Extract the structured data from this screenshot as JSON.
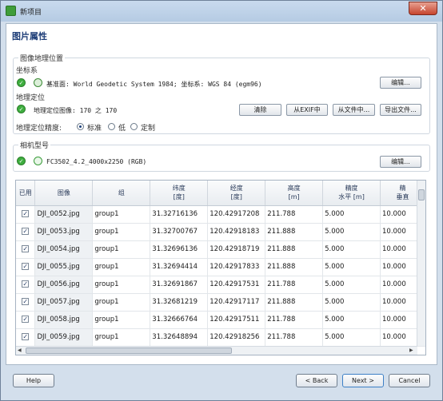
{
  "window": {
    "title": "新项目",
    "close_label": "✕"
  },
  "page_title": "图片属性",
  "geolocation_group": {
    "legend": "图像地理位置",
    "coordinate_system": {
      "label": "坐标系",
      "value": "基准面: World Geodetic System 1984; 坐标系: WGS 84 (egm96)",
      "edit_button": "编辑..."
    },
    "geolocation": {
      "label": "地理定位",
      "value": "地理定位图像: 170 之 170",
      "buttons": [
        "清除",
        "从EXIF中",
        "从文件中...",
        "导出文件..."
      ]
    },
    "accuracy": {
      "label": "地理定位精度:",
      "options": [
        "标准",
        "低",
        "定制"
      ],
      "selected": "标准"
    }
  },
  "camera_group": {
    "legend": "相机型号",
    "value": "FC3502_4.2_4000x2250 (RGB)",
    "edit_button": "编辑..."
  },
  "table": {
    "columns": [
      "已用",
      "图像",
      "组",
      "纬度\n[度]",
      "经度\n[度]",
      "高度\n[m]",
      "精度\n水平 [m]",
      "精\n垂直"
    ],
    "rows": [
      {
        "checked": true,
        "image": "DJI_0052.jpg",
        "group": "group1",
        "lat": "31.32716136",
        "lon": "120.42917208",
        "alt": "211.788",
        "h_acc": "5.000",
        "v_acc": "10.000"
      },
      {
        "checked": true,
        "image": "DJI_0053.jpg",
        "group": "group1",
        "lat": "31.32700767",
        "lon": "120.42918183",
        "alt": "211.888",
        "h_acc": "5.000",
        "v_acc": "10.000"
      },
      {
        "checked": true,
        "image": "DJI_0054.jpg",
        "group": "group1",
        "lat": "31.32696136",
        "lon": "120.42918719",
        "alt": "211.888",
        "h_acc": "5.000",
        "v_acc": "10.000"
      },
      {
        "checked": true,
        "image": "DJI_0055.jpg",
        "group": "group1",
        "lat": "31.32694414",
        "lon": "120.42917833",
        "alt": "211.888",
        "h_acc": "5.000",
        "v_acc": "10.000"
      },
      {
        "checked": true,
        "image": "DJI_0056.jpg",
        "group": "group1",
        "lat": "31.32691867",
        "lon": "120.42917531",
        "alt": "211.788",
        "h_acc": "5.000",
        "v_acc": "10.000"
      },
      {
        "checked": true,
        "image": "DJI_0057.jpg",
        "group": "group1",
        "lat": "31.32681219",
        "lon": "120.42917117",
        "alt": "211.888",
        "h_acc": "5.000",
        "v_acc": "10.000"
      },
      {
        "checked": true,
        "image": "DJI_0058.jpg",
        "group": "group1",
        "lat": "31.32666764",
        "lon": "120.42917511",
        "alt": "211.788",
        "h_acc": "5.000",
        "v_acc": "10.000"
      },
      {
        "checked": true,
        "image": "DJI_0059.jpg",
        "group": "group1",
        "lat": "31.32648894",
        "lon": "120.42918256",
        "alt": "211.788",
        "h_acc": "5.000",
        "v_acc": "10.000"
      }
    ]
  },
  "footer": {
    "help": "Help",
    "back": "< Back",
    "next": "Next >",
    "cancel": "Cancel"
  },
  "colors": {
    "window_bg": "#d3dfec",
    "title_accent": "#1e3e78",
    "check_green": "#3fae3f",
    "close_red": "#c6452e"
  },
  "icons": {
    "title": "app-icon",
    "status": "green-check-icon",
    "coordinate": "globe-icon",
    "camera": "camera-icon"
  }
}
